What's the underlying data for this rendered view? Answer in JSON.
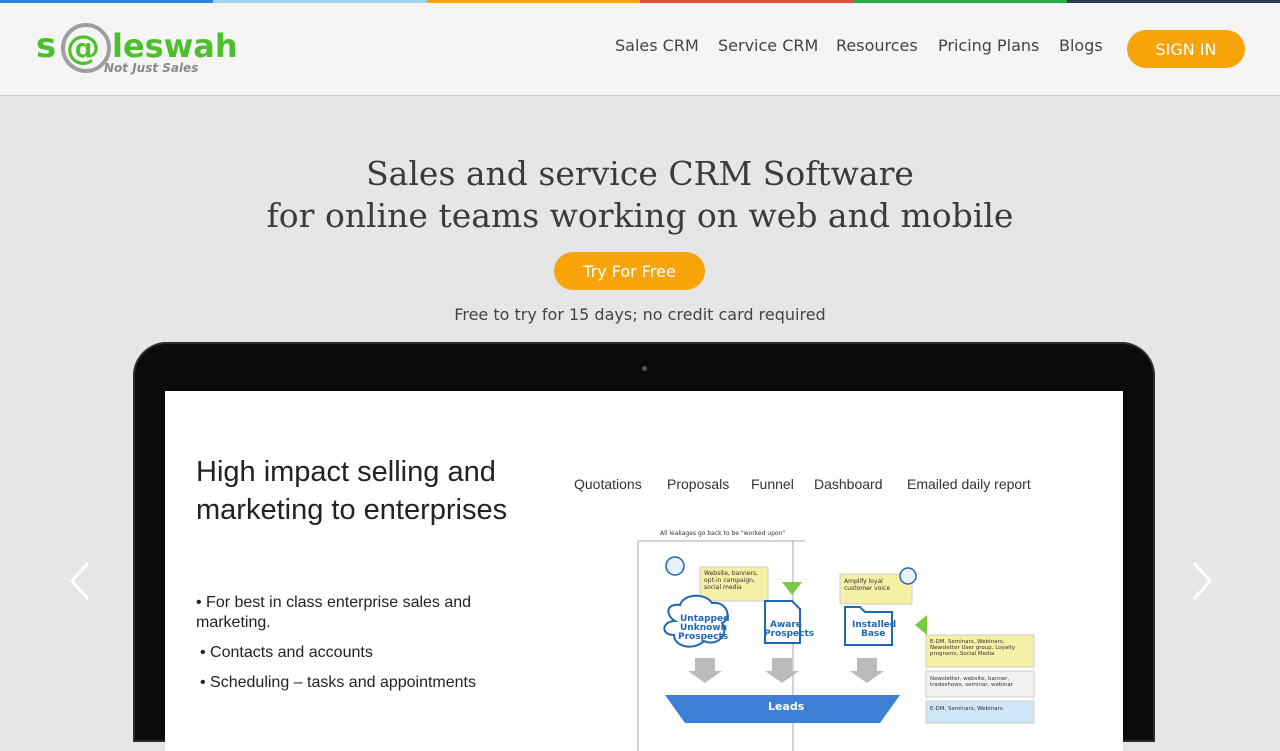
{
  "brand": {
    "logo_main": "s@leswah!",
    "logo_tagline": "Not Just Sales",
    "colors": [
      "#2f80d9",
      "#9fd3f0",
      "#f7a30a",
      "#e84c3d",
      "#27a744",
      "#2f3e4e"
    ]
  },
  "nav": {
    "items": [
      "Sales CRM",
      "Service CRM",
      "Resources",
      "Pricing Plans",
      "Blogs"
    ],
    "signin_label": "SIGN IN"
  },
  "hero": {
    "title_line1": "Sales and service CRM Software",
    "title_line2": "for online teams working on web and mobile",
    "cta_label": "Try For Free",
    "subtext": "Free to try for 15 days; no credit card required"
  },
  "slide": {
    "heading": "High impact selling and marketing to enterprises",
    "bullets": [
      "For best in class enterprise sales and marketing.",
      "Contacts and accounts",
      "Scheduling – tasks and appointments"
    ],
    "tabs": [
      "Quotations",
      "Proposals",
      "Funnel",
      "Dashboard",
      "Emailed daily report"
    ],
    "diagram": {
      "top_note": "All leakages go back to be \"worked upon\"",
      "note1": "Website, banners, opt-in campaign, social media",
      "note2": "Amplify loyal customer voice",
      "cloud_label": "Untapped Unknown Prospects",
      "doc_label": "Aware Prospects",
      "folder_label": "Installed Base",
      "side_note1": "E-DM, Seminars, Webinars, Newsletter User group, Loyalty programs, Social Media",
      "side_note2": "Newsletter, website, banner, tradeshows, seminar, webinar",
      "side_note3": "E-DM, Seminars, Webinars",
      "funnel_label": "Leads"
    }
  },
  "carousel": {
    "prev_icon": "chevron-left-icon",
    "next_icon": "chevron-right-icon"
  }
}
